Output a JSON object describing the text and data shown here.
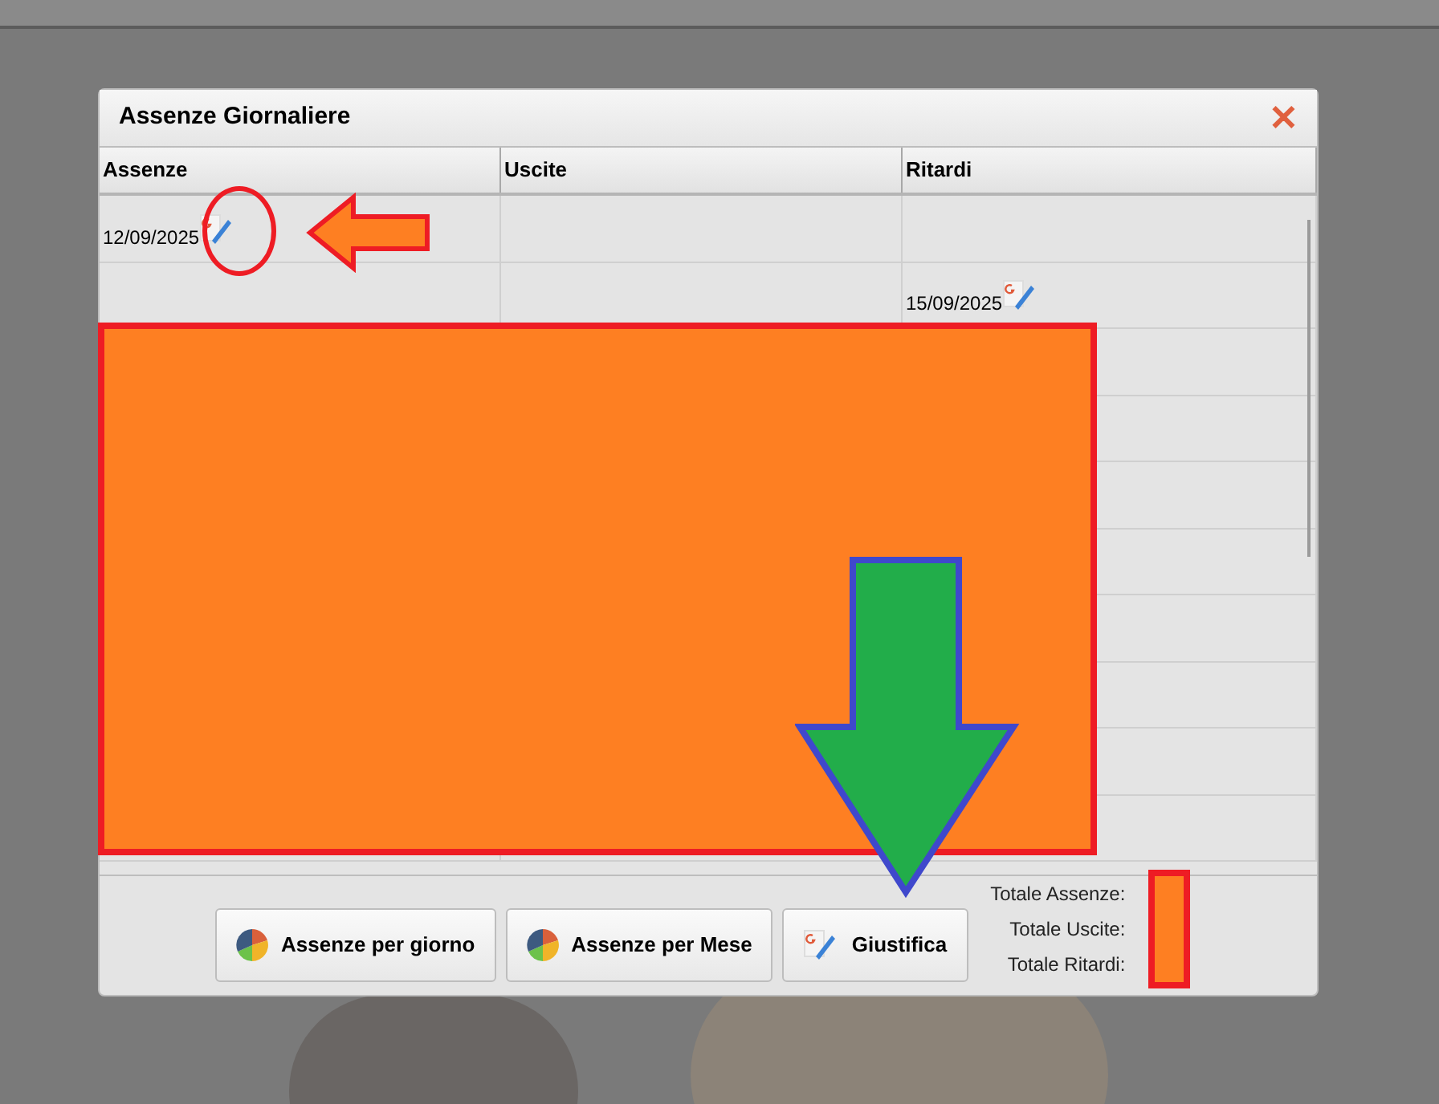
{
  "window": {
    "title": "Assenze Giornaliere",
    "close": "✕"
  },
  "table": {
    "columns": [
      "Assenze",
      "Uscite",
      "Ritardi"
    ],
    "rows": [
      {
        "cells": [
          {
            "date": "12/09/2025"
          },
          {},
          {}
        ]
      },
      {
        "cells": [
          {},
          {},
          {
            "date": "15/09/2025"
          }
        ]
      }
    ]
  },
  "buttons": [
    {
      "label": "Assenze per giorno",
      "kind": "chart"
    },
    {
      "label": "Assenze per Mese",
      "kind": "chart"
    },
    {
      "label": "Giustifica",
      "kind": "justify"
    }
  ],
  "totals": [
    "Totale Assenze:",
    "Totale Uscite:",
    "Totale Ritardi:"
  ]
}
